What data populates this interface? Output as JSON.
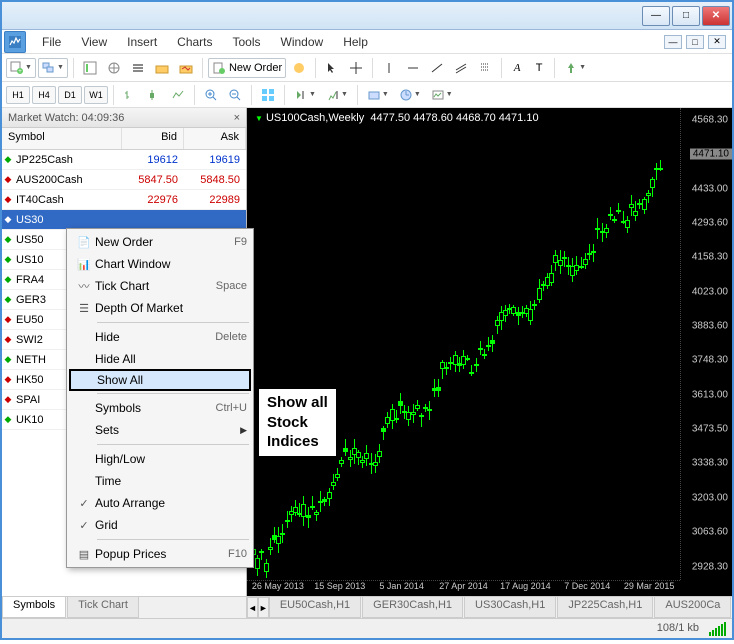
{
  "window": {
    "minimize": "—",
    "maximize": "□",
    "close": "✕"
  },
  "menubar": [
    "File",
    "View",
    "Insert",
    "Charts",
    "Tools",
    "Window",
    "Help"
  ],
  "toolbar1": {
    "new_order": "New Order",
    "letter_a": "A",
    "letter_t": "T"
  },
  "timeframes": [
    "H1",
    "H4",
    "D1",
    "W1"
  ],
  "market_watch": {
    "title": "Market Watch: 04:09:36",
    "cols": [
      "Symbol",
      "Bid",
      "Ask"
    ],
    "rows": [
      {
        "dir": "up",
        "sym": "JP225Cash",
        "bid": "19612",
        "ask": "19619",
        "cls": "blue"
      },
      {
        "dir": "down",
        "sym": "AUS200Cash",
        "bid": "5847.50",
        "ask": "5848.50",
        "cls": "red"
      },
      {
        "dir": "down",
        "sym": "IT40Cash",
        "bid": "22976",
        "ask": "22989",
        "cls": "red"
      },
      {
        "dir": "up",
        "sym": "US30",
        "bid": "",
        "ask": "",
        "cls": "sel"
      },
      {
        "dir": "up",
        "sym": "US50",
        "bid": "",
        "ask": "",
        "cls": ""
      },
      {
        "dir": "up",
        "sym": "US10",
        "bid": "",
        "ask": "",
        "cls": ""
      },
      {
        "dir": "up",
        "sym": "FRA4",
        "bid": "",
        "ask": "",
        "cls": ""
      },
      {
        "dir": "up",
        "sym": "GER3",
        "bid": "",
        "ask": "",
        "cls": ""
      },
      {
        "dir": "down",
        "sym": "EU50",
        "bid": "",
        "ask": "",
        "cls": ""
      },
      {
        "dir": "down",
        "sym": "SWI2",
        "bid": "",
        "ask": "",
        "cls": ""
      },
      {
        "dir": "up",
        "sym": "NETH",
        "bid": "",
        "ask": "",
        "cls": ""
      },
      {
        "dir": "down",
        "sym": "HK50",
        "bid": "",
        "ask": "",
        "cls": ""
      },
      {
        "dir": "down",
        "sym": "SPAI",
        "bid": "",
        "ask": "",
        "cls": ""
      },
      {
        "dir": "up",
        "sym": "UK10",
        "bid": "",
        "ask": "",
        "cls": ""
      }
    ]
  },
  "context_menu": {
    "items": [
      {
        "icon": "new",
        "label": "New Order",
        "shortcut": "F9"
      },
      {
        "icon": "chart",
        "label": "Chart Window",
        "shortcut": ""
      },
      {
        "icon": "tick",
        "label": "Tick Chart",
        "shortcut": "Space"
      },
      {
        "icon": "depth",
        "label": "Depth Of Market",
        "shortcut": ""
      },
      {
        "sep": true
      },
      {
        "icon": "",
        "label": "Hide",
        "shortcut": "Delete"
      },
      {
        "icon": "",
        "label": "Hide All",
        "shortcut": ""
      },
      {
        "icon": "",
        "label": "Show All",
        "shortcut": "",
        "selected": true
      },
      {
        "sep": true
      },
      {
        "icon": "",
        "label": "Symbols",
        "shortcut": "Ctrl+U"
      },
      {
        "icon": "",
        "label": "Sets",
        "shortcut": "",
        "submenu": true
      },
      {
        "sep": true
      },
      {
        "icon": "",
        "label": "High/Low",
        "shortcut": ""
      },
      {
        "icon": "",
        "label": "Time",
        "shortcut": ""
      },
      {
        "icon": "check",
        "label": "Auto Arrange",
        "shortcut": ""
      },
      {
        "icon": "check",
        "label": "Grid",
        "shortcut": ""
      },
      {
        "sep": true
      },
      {
        "icon": "popup",
        "label": "Popup Prices",
        "shortcut": "F10"
      }
    ]
  },
  "callout": {
    "l1": "Show all",
    "l2": "Stock",
    "l3": "Indices"
  },
  "chart": {
    "title_symbol": "US100Cash,Weekly",
    "title_ohlc": "4477.50 4478.60 4468.70 4471.10",
    "price_ticks": [
      "4568.30",
      "4471.10",
      "4433.00",
      "4293.60",
      "4158.30",
      "4023.00",
      "3883.60",
      "3748.30",
      "3613.00",
      "3473.50",
      "3338.30",
      "3203.00",
      "3063.60",
      "2928.30"
    ],
    "time_ticks": [
      "26 May 2013",
      "15 Sep 2013",
      "5 Jan 2014",
      "27 Apr 2014",
      "17 Aug 2014",
      "7 Dec 2014",
      "29 Mar 2015"
    ]
  },
  "bottom_tabs_left": [
    "Symbols",
    "Tick Chart"
  ],
  "bottom_tabs_right": [
    "EU50Cash,H1",
    "GER30Cash,H1",
    "US30Cash,H1",
    "JP225Cash,H1",
    "AUS200Ca"
  ],
  "status": {
    "kb": "108/1 kb"
  },
  "chart_data": {
    "type": "candlestick",
    "title": "US100Cash,Weekly",
    "ylim": [
      2928,
      4568
    ],
    "x_range": [
      "26 May 2013",
      "29 Mar 2015"
    ],
    "note": "Weekly candlestick uptrend; ~100 bars; values read from axis only",
    "current": 4471.1
  }
}
